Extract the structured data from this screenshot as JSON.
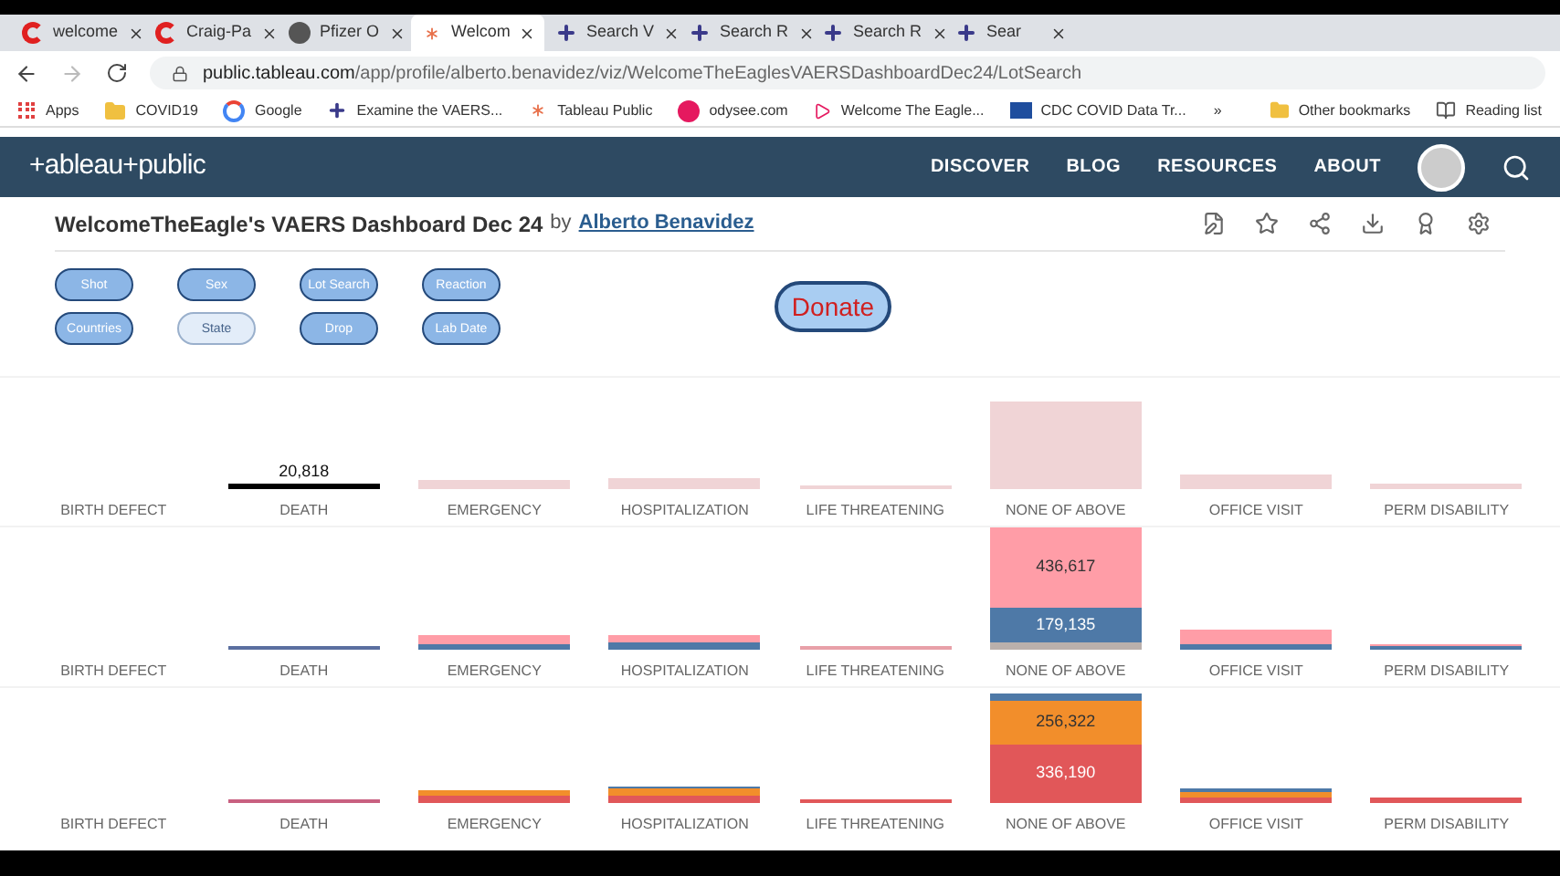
{
  "browser": {
    "tabs": [
      {
        "label": "welcome",
        "selected": false,
        "kind": "c"
      },
      {
        "label": "Craig-Pa",
        "selected": false,
        "kind": "c"
      },
      {
        "label": "Pfizer O",
        "selected": false,
        "kind": "globe"
      },
      {
        "label": "Welcom",
        "selected": true,
        "kind": "tableau"
      },
      {
        "label": "Search V",
        "selected": false,
        "kind": "plus"
      },
      {
        "label": "Search R",
        "selected": false,
        "kind": "plus"
      },
      {
        "label": "Search R",
        "selected": false,
        "kind": "plus"
      },
      {
        "label": "Sear",
        "selected": false,
        "kind": "plus"
      }
    ],
    "url_host": "public.tableau.com",
    "url_path": "/app/profile/alberto.benavidez/viz/WelcomeTheEaglesVAERSDashboardDec24/LotSearch",
    "bookmarks": [
      {
        "label": "Apps",
        "kind": "apps"
      },
      {
        "label": "COVID19",
        "kind": "folder"
      },
      {
        "label": "Google",
        "kind": "google"
      },
      {
        "label": "Examine the VAERS...",
        "kind": "plus"
      },
      {
        "label": "Tableau Public",
        "kind": "tableau"
      },
      {
        "label": "odysee.com",
        "kind": "odysee"
      },
      {
        "label": "Welcome The Eagle...",
        "kind": "play"
      },
      {
        "label": "CDC COVID Data Tr...",
        "kind": "cdc"
      }
    ],
    "more": "»",
    "other_bookmarks": "Other bookmarks",
    "reading_list": "Reading list"
  },
  "site": {
    "logo": "+ableau+public",
    "nav": [
      "DISCOVER",
      "BLOG",
      "RESOURCES",
      "ABOUT"
    ]
  },
  "viz": {
    "title": "WelcomeTheEagle's VAERS Dashboard Dec 24",
    "by": "by",
    "author": "Alberto Benavidez"
  },
  "buttons": [
    {
      "label": "Shot",
      "disabled": false
    },
    {
      "label": "Sex",
      "disabled": false
    },
    {
      "label": "Lot Search",
      "disabled": false
    },
    {
      "label": "Reaction",
      "disabled": false
    },
    {
      "label": "Countries",
      "disabled": false
    },
    {
      "label": "State",
      "disabled": true
    },
    {
      "label": "Drop",
      "disabled": false
    },
    {
      "label": "Lab Date",
      "disabled": false
    }
  ],
  "donate": "Donate",
  "chart_rows": [
    {
      "columns": [
        {
          "category": "BIRTH DEFECT"
        },
        {
          "category": "DEATH",
          "labels": [
            "20,818"
          ]
        },
        {
          "category": "EMERGENCY"
        },
        {
          "category": "HOSPITALIZATION"
        },
        {
          "category": "LIFE THREATENING"
        },
        {
          "category": "NONE OF ABOVE"
        },
        {
          "category": "OFFICE VISIT"
        },
        {
          "category": "PERM DISABILITY"
        }
      ]
    },
    {
      "columns": [
        {
          "category": "BIRTH DEFECT"
        },
        {
          "category": "DEATH"
        },
        {
          "category": "EMERGENCY"
        },
        {
          "category": "HOSPITALIZATION"
        },
        {
          "category": "LIFE THREATENING"
        },
        {
          "category": "NONE OF ABOVE",
          "labels": [
            "436,617",
            "179,135"
          ]
        },
        {
          "category": "OFFICE VISIT"
        },
        {
          "category": "PERM DISABILITY"
        }
      ]
    },
    {
      "columns": [
        {
          "category": "BIRTH DEFECT"
        },
        {
          "category": "DEATH"
        },
        {
          "category": "EMERGENCY"
        },
        {
          "category": "HOSPITALIZATION"
        },
        {
          "category": "LIFE THREATENING"
        },
        {
          "category": "NONE OF ABOVE",
          "labels": [
            "256,322",
            "336,190"
          ]
        },
        {
          "category": "OFFICE VISIT"
        },
        {
          "category": "PERM DISABILITY"
        }
      ]
    }
  ]
}
